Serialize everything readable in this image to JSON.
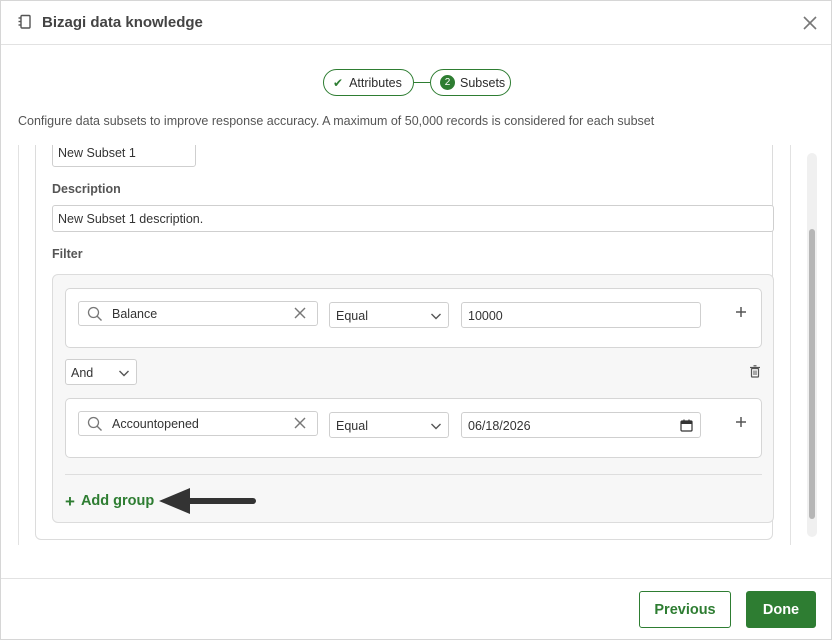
{
  "dialog": {
    "title": "Bizagi data knowledge",
    "icons": {
      "title": "document-icon",
      "close": "close-icon"
    }
  },
  "stepper": {
    "steps": [
      {
        "label": "Attributes",
        "state": "completed",
        "marker": "✔"
      },
      {
        "label": "Subsets",
        "state": "active",
        "marker": "2"
      }
    ]
  },
  "description": "Configure data subsets to improve response accuracy. A maximum of 50,000 records is considered for each subset",
  "subset": {
    "name_value": "New Subset 1",
    "description_label": "Description",
    "description_value": "New Subset 1 description.",
    "filter_label": "Filter",
    "filter": {
      "groups": [
        {
          "attribute": "Balance",
          "operator": "Equal",
          "value": "10000"
        },
        {
          "attribute": "Accountopened",
          "operator": "Equal",
          "value": "06/18/2026"
        }
      ],
      "connector": "And",
      "add_group_label": "Add group",
      "add_group_glyph": "+"
    }
  },
  "footer": {
    "previous_label": "Previous",
    "done_label": "Done"
  },
  "colors": {
    "accent": "#2e7d32",
    "border": "#cfcfcf",
    "filter_bg": "#f7f7f7",
    "arrow": "#333333"
  }
}
